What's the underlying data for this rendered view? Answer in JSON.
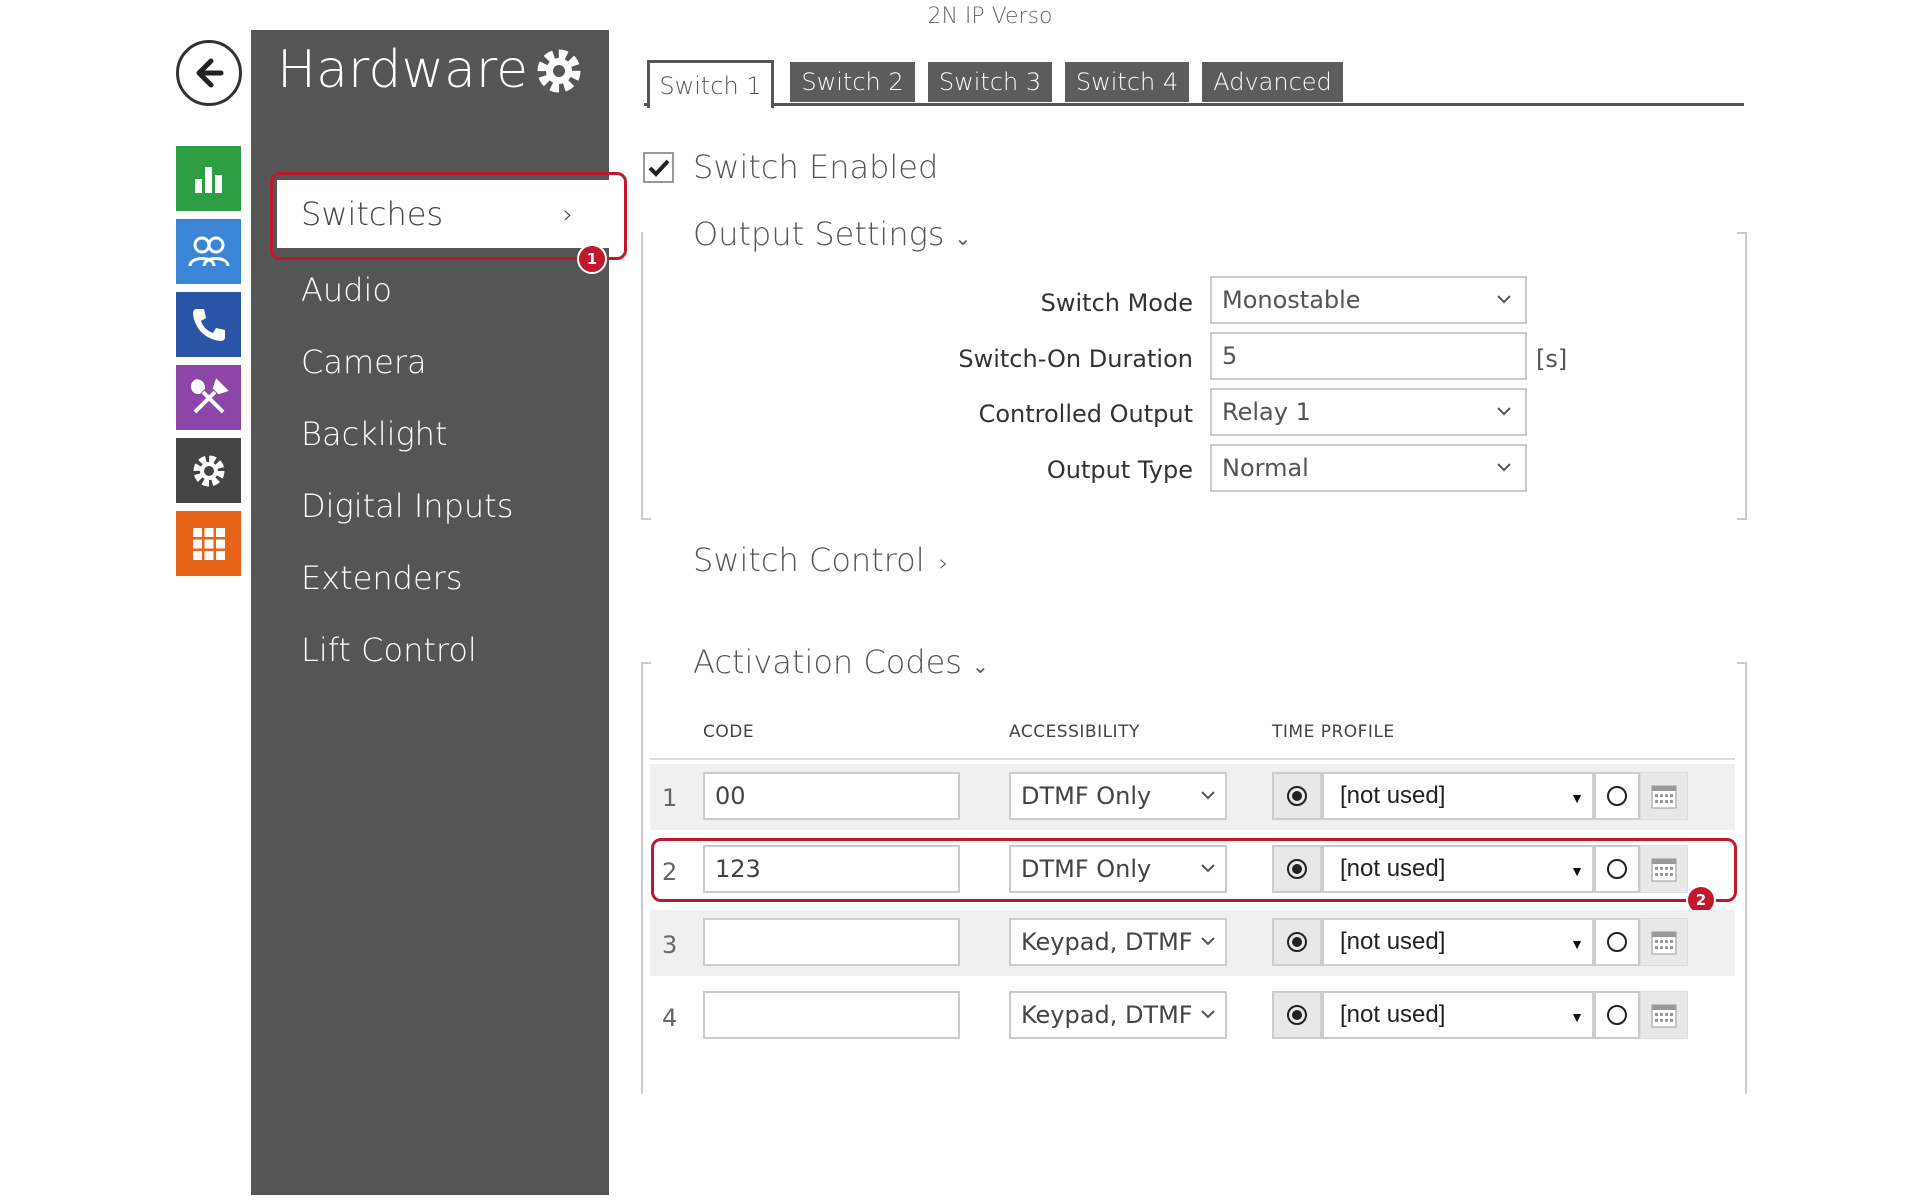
{
  "device_title": "2N IP Verso",
  "sidebar": {
    "title": "Hardware",
    "items": [
      {
        "label": "Switches"
      },
      {
        "label": "Audio"
      },
      {
        "label": "Camera"
      },
      {
        "label": "Backlight"
      },
      {
        "label": "Digital Inputs"
      },
      {
        "label": "Extenders"
      },
      {
        "label": "Lift Control"
      }
    ]
  },
  "rail_icons": [
    "back-arrow-icon",
    "status-chart-icon",
    "directory-users-icon",
    "phone-icon",
    "tools-icon",
    "settings-gear-icon",
    "apps-grid-icon"
  ],
  "rail_colors": [
    "#2e9e45",
    "#3a85d5",
    "#2b56a8",
    "#8c46a8",
    "#444444",
    "#e86419"
  ],
  "tabs": [
    "Switch 1",
    "Switch 2",
    "Switch 3",
    "Switch 4",
    "Advanced"
  ],
  "switch_enabled_label": "Switch Enabled",
  "switch_enabled_checked": true,
  "output_settings": {
    "title": "Output Settings",
    "switch_mode_label": "Switch Mode",
    "switch_mode_value": "Monostable",
    "duration_label": "Switch-On Duration",
    "duration_value": "5",
    "duration_unit": "[s]",
    "controlled_output_label": "Controlled Output",
    "controlled_output_value": "Relay 1",
    "output_type_label": "Output Type",
    "output_type_value": "Normal"
  },
  "switch_control_title": "Switch Control",
  "activation_codes": {
    "title": "Activation Codes",
    "columns": [
      "CODE",
      "ACCESSIBILITY",
      "TIME PROFILE"
    ],
    "rows": [
      {
        "num": "1",
        "code": "00",
        "accessibility": "DTMF Only",
        "time_profile": "[not used]"
      },
      {
        "num": "2",
        "code": "123",
        "accessibility": "DTMF Only",
        "time_profile": "[not used]"
      },
      {
        "num": "3",
        "code": "",
        "accessibility": "Keypad, DTMF",
        "time_profile": "[not used]"
      },
      {
        "num": "4",
        "code": "",
        "accessibility": "Keypad, DTMF",
        "time_profile": "[not used]"
      }
    ]
  },
  "callouts": [
    "1",
    "2"
  ],
  "accent_color": "#c0192e"
}
